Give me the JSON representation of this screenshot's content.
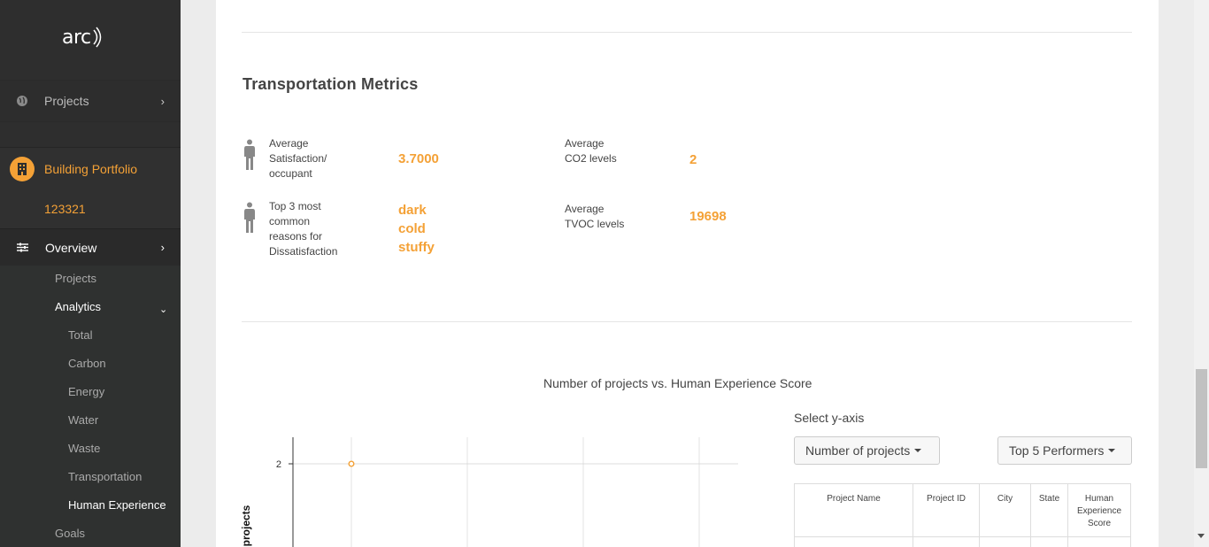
{
  "sidebar": {
    "logo_text": "arc",
    "projects_top": "Projects",
    "portfolio_title": "Building Portfolio",
    "portfolio_id": "123321",
    "overview": "Overview",
    "items": {
      "projects": "Projects",
      "analytics": "Analytics",
      "total": "Total",
      "carbon": "Carbon",
      "energy": "Energy",
      "water": "Water",
      "waste": "Waste",
      "transportation": "Transportation",
      "human_experience": "Human Experience",
      "goals": "Goals"
    }
  },
  "section": {
    "title": "Transportation Metrics",
    "metrics": {
      "satisfaction_label_1": "Average",
      "satisfaction_label_2": "Satisfaction/",
      "satisfaction_label_3": "occupant",
      "satisfaction_value": "3.7000",
      "reasons_label_1": "Top 3 most",
      "reasons_label_2": "common",
      "reasons_label_3": "reasons for",
      "reasons_label_4": "Dissatisfaction",
      "reason_1": "dark",
      "reason_2": "cold",
      "reason_3": "stuffy",
      "co2_label_1": "Average",
      "co2_label_2": "CO2 levels",
      "co2_value": "2",
      "tvoc_label_1": "Average",
      "tvoc_label_2": "TVOC levels",
      "tvoc_value": "19698"
    }
  },
  "chart": {
    "title": "Number of projects vs. Human Experience Score",
    "ylabel_visible": "r of projects",
    "select_label": "Select y-axis",
    "y_dropdown": "Number of projects",
    "performers_dropdown": "Top 5 Performers"
  },
  "chart_data": {
    "type": "scatter",
    "title": "Number of projects vs. Human Experience Score",
    "ylabel": "Number of projects",
    "y_ticks": [
      "2"
    ],
    "points": [
      {
        "y": 2
      }
    ],
    "grid": true,
    "point_color": "#f4a136"
  },
  "table": {
    "headers": [
      "Project Name",
      "Project ID",
      "City",
      "State",
      "Human Experience Score"
    ]
  },
  "colors": {
    "accent": "#f4a136",
    "sidebar_bg": "#2e2e2e"
  }
}
